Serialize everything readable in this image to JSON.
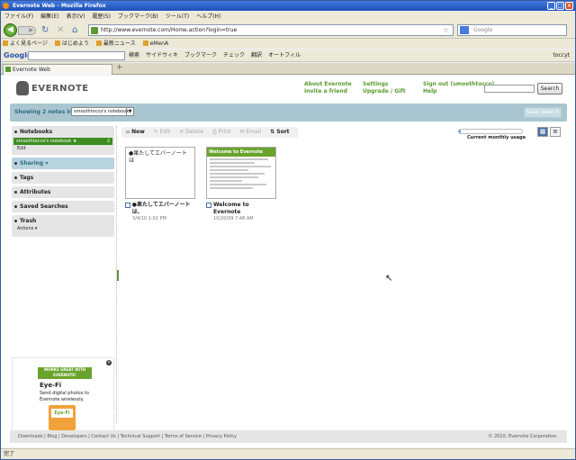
{
  "window": {
    "title": "Evernote Web - Mozilla Firefox"
  },
  "menu": [
    "ファイル(F)",
    "編集(E)",
    "表示(V)",
    "履歴(S)",
    "ブックマーク(B)",
    "ツール(T)",
    "ヘルプ(H)"
  ],
  "nav": {
    "url": "http://www.evernote.com/Home.action?login=true",
    "search_placeholder": "Google"
  },
  "bookmarks": [
    "よく見るページ",
    "はじめよう",
    "最新ニュース",
    "eMenA"
  ],
  "googlebar": {
    "logo": "Google",
    "items": [
      "検索",
      "サイドウィキ",
      "ブックマーク",
      "チェック",
      "翻訳",
      "オートフィル"
    ],
    "user": "toccyt"
  },
  "tab": {
    "label": "Evernote Web",
    "new_tab": "+"
  },
  "header": {
    "logo": "EVERNOTE",
    "links_col1": [
      "About Evernote",
      "Invite a friend"
    ],
    "links_col2": [
      "Settings",
      "Upgrade / Gift"
    ],
    "links_col3": [
      "Sign out (smoothtocco)",
      "Help"
    ],
    "search_button": "Search"
  },
  "showbar": {
    "label": "Showing 2 notes in",
    "notebook": "smoothtocco's notebook",
    "save_search": "Save search"
  },
  "sidebar": {
    "notebooks": "Notebooks",
    "notebook_item": "smoothtocco's notebook ★",
    "notebook_count": "2",
    "edit": "Edit",
    "sharing": "Sharing",
    "tags": "Tags",
    "attributes": "Attributes",
    "saved_searches": "Saved Searches",
    "trash": "Trash",
    "actions": "Actions"
  },
  "ad": {
    "badge": "WORKS GREAT WITH EVERNOTE!",
    "name": "Eye-Fi",
    "desc": "Send digital photos to Evernote wirelessly.",
    "card": "Eye-Fi"
  },
  "toolbar": {
    "new": "New",
    "edit": "Edit",
    "delete": "Delete",
    "print": "Print",
    "email": "Email",
    "sort": "Sort"
  },
  "usage": {
    "label": "Current monthly usage",
    "fraction": 0.03
  },
  "notes": [
    {
      "thumb_text": "●果たしてエバーノートは",
      "title": "●果たしてエバーノートは、",
      "date": "3/4/10 1:02 PM"
    },
    {
      "thumb_title": "Welcome to Evernote",
      "title": "Welcome to Evernote",
      "date": "10/20/09 7:48 AM"
    }
  ],
  "footer": {
    "links": "Downloads | Blog | Developers | Contact Us | Technical Support | Terms of Service | Privacy Policy",
    "copyright": "© 2010, Evernote Corporation."
  },
  "status": "完了"
}
